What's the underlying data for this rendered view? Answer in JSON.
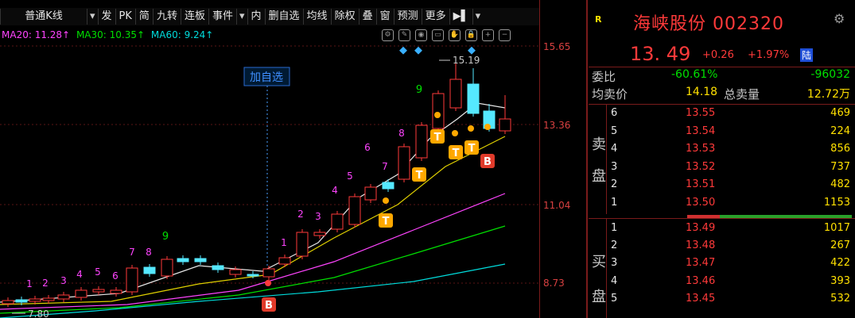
{
  "toolbar": {
    "items": [
      "普通K线",
      "▾",
      "发",
      "PK",
      "简",
      "九转",
      "连板",
      "事件",
      "▾",
      "内",
      "删自选",
      "均线",
      "除权",
      "叠",
      "窗",
      "预测",
      "更多",
      "▶▌",
      "▾"
    ]
  },
  "ma_legend": [
    {
      "label": "MA20: 11.28↑",
      "color": "#ff44ff"
    },
    {
      "label": "MA30: 10.35↑",
      "color": "#00e000"
    },
    {
      "label": "MA60: 9.24↑",
      "color": "#00dcdc"
    }
  ],
  "price_axis": [
    "15.65",
    "13.36",
    "11.04",
    "8.73"
  ],
  "chart_data": {
    "type": "candlestick",
    "high_label": "15.19",
    "low_label": "7.80",
    "add_watchlist_label": "加自选",
    "nine_turn_top": [
      "1",
      "2",
      "3",
      "4",
      "5",
      "6",
      "7",
      "8",
      "9"
    ],
    "nine_turn_second": [
      "1",
      "2",
      "3",
      "4",
      "5",
      "6",
      "7",
      "8",
      "9"
    ],
    "nine_turn_third": [
      "1",
      "2",
      "3",
      "4",
      "5",
      "6",
      "7",
      "8",
      "9"
    ],
    "b_marker": "B",
    "t_marker": "T"
  },
  "quote": {
    "r_badge": "R",
    "name": "海峡股份 002320",
    "price": "13. 49",
    "change": "+0.26",
    "change_pct": "+1.97%",
    "exchange": "陆",
    "wb_label": "委比",
    "wb_pct": "-60.61%",
    "wb_diff": "-96032",
    "avg_sell_label": "均卖价",
    "avg_sell_value": "14.18",
    "total_sell_label": "总卖量",
    "total_sell_value": "12.72万",
    "sell_side": "卖盘",
    "buy_side": "买盘",
    "sell": [
      {
        "n": "6",
        "p": "13.55",
        "v": "469"
      },
      {
        "n": "5",
        "p": "13.54",
        "v": "224"
      },
      {
        "n": "4",
        "p": "13.53",
        "v": "856"
      },
      {
        "n": "3",
        "p": "13.52",
        "v": "737"
      },
      {
        "n": "2",
        "p": "13.51",
        "v": "482"
      },
      {
        "n": "1",
        "p": "13.50",
        "v": "1153"
      }
    ],
    "buy": [
      {
        "n": "1",
        "p": "13.49",
        "v": "1017"
      },
      {
        "n": "2",
        "p": "13.48",
        "v": "267"
      },
      {
        "n": "3",
        "p": "13.47",
        "v": "422"
      },
      {
        "n": "4",
        "p": "13.46",
        "v": "393"
      },
      {
        "n": "5",
        "p": "13.45",
        "v": "532"
      }
    ]
  },
  "colors": {
    "up": "#ff3a3a",
    "down": "#00e000",
    "accent": "#ffe000",
    "cyan": "#55e8ff"
  }
}
